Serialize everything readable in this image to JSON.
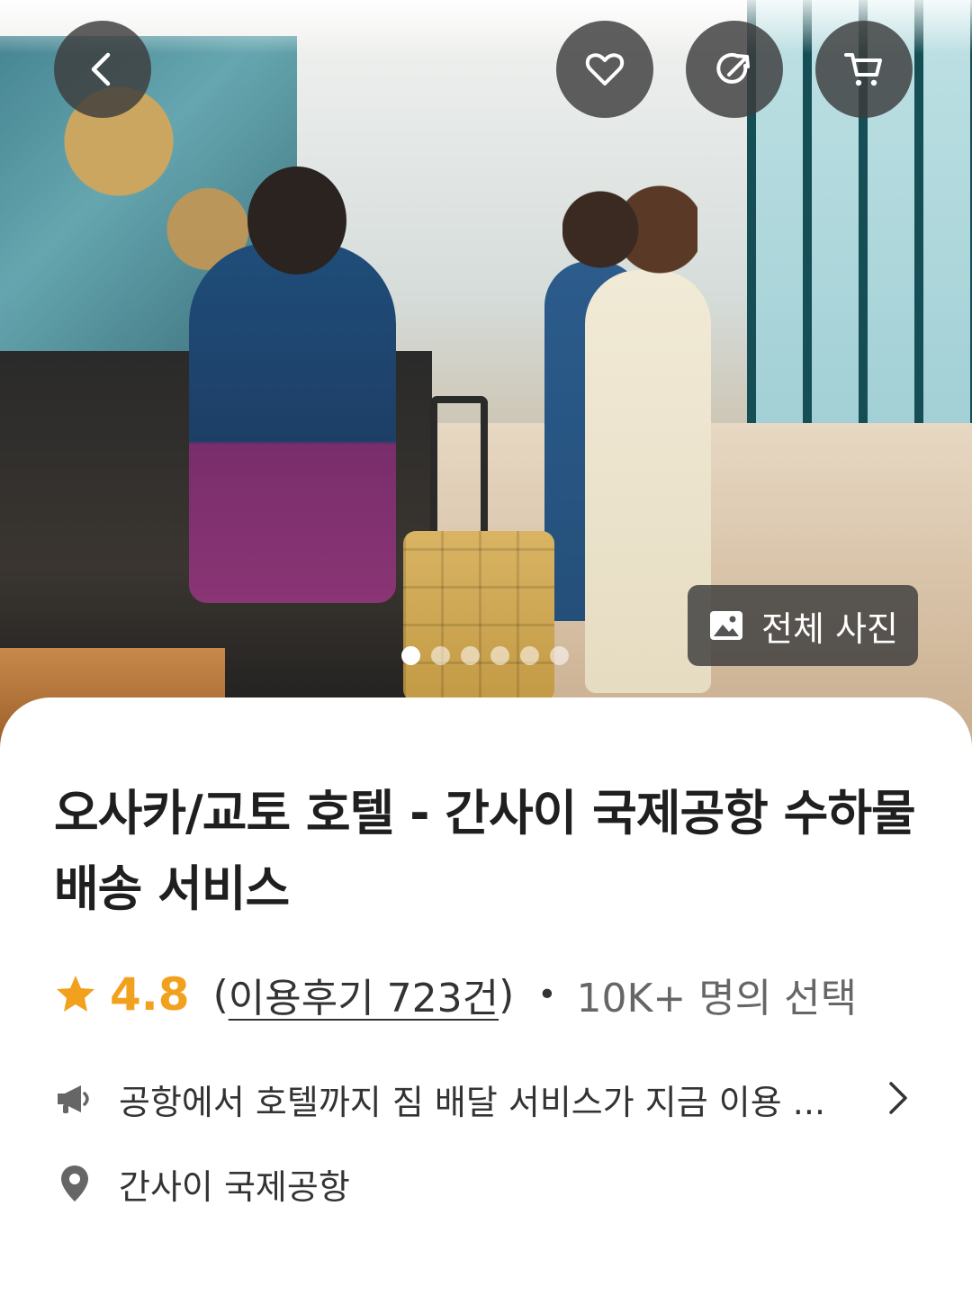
{
  "hero": {
    "photo_alt": "hotel-lobby-photo",
    "carousel": {
      "total": 6,
      "active_index": 0
    },
    "all_photos_label": "전체 사진"
  },
  "header_icons": {
    "back": "chevron-left-icon",
    "like": "heart-icon",
    "share": "share-icon",
    "cart": "cart-icon"
  },
  "product": {
    "title": "오사카/교토 호텔 - 간사이 국제공항 수하물 배송 서비스",
    "rating": "4.8",
    "paren_open": "(",
    "review_link": "이용후기 723건",
    "paren_close": ")",
    "separator": "•",
    "chosen_count": "10K+ 명의 선택",
    "notice": "공항에서 호텔까지 짐 배달 서비스가 지금 이용 ...",
    "location": "간사이 국제공항"
  },
  "colors": {
    "accent_star": "#f2a11e",
    "overlay_button": "#3c3c3c",
    "text_primary": "#1f1f1f",
    "text_secondary": "#666666"
  }
}
